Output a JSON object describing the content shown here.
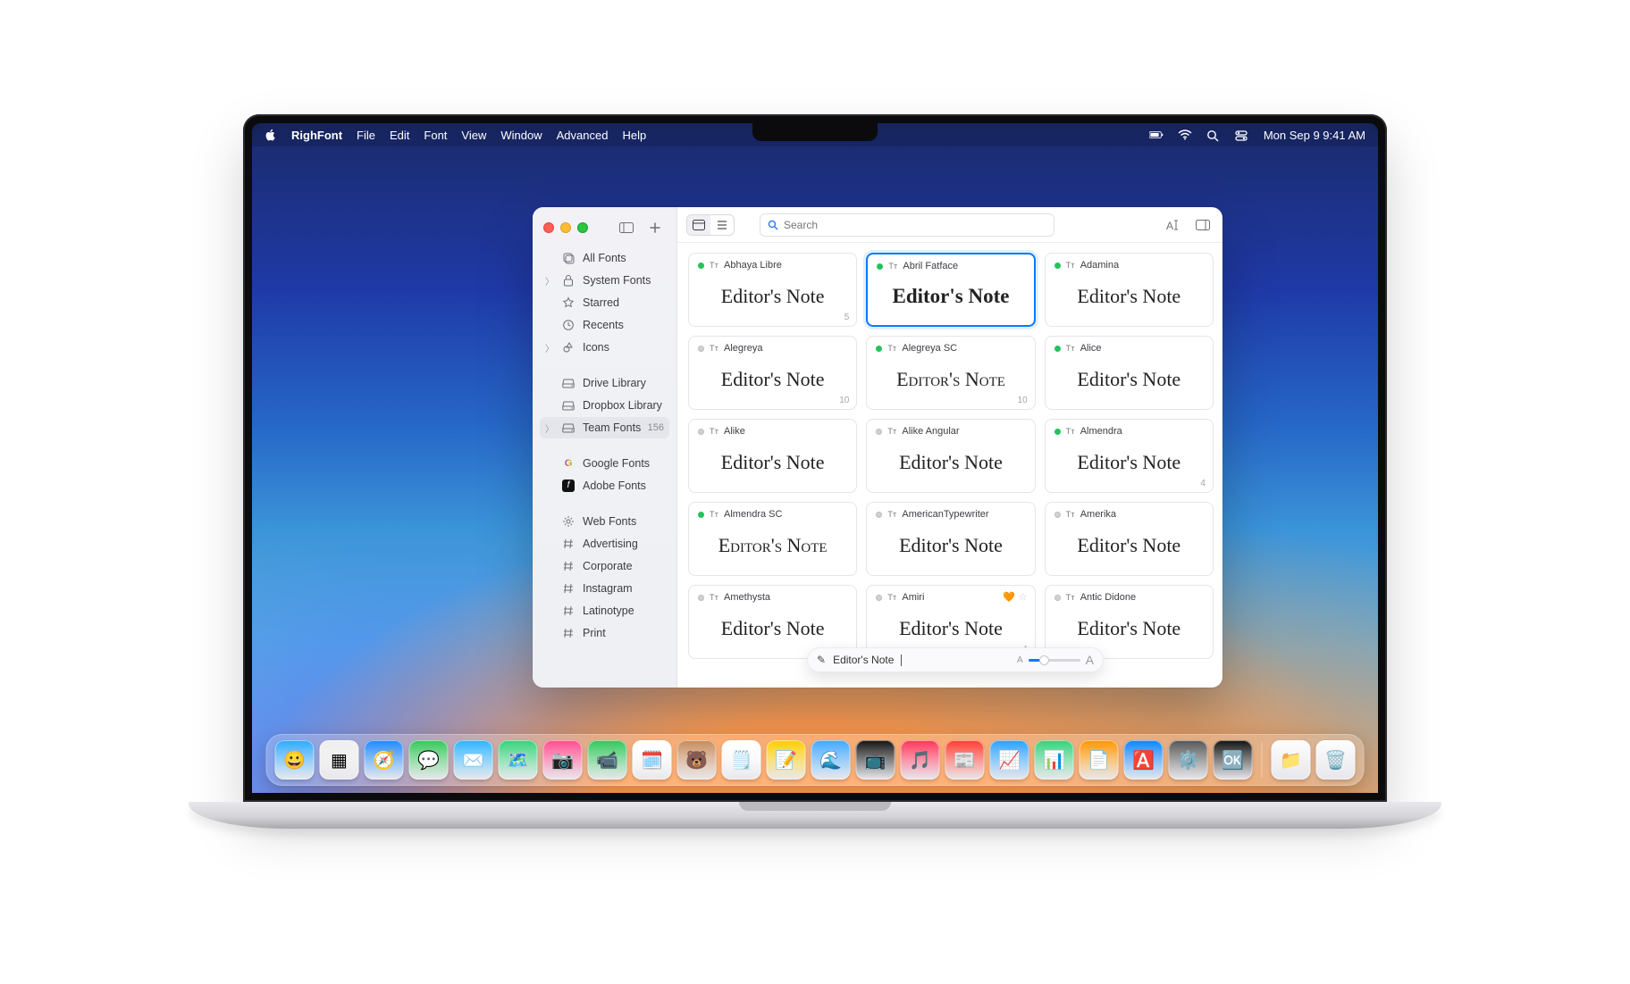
{
  "menubar": {
    "app": "RighFont",
    "items": [
      "File",
      "Edit",
      "Font",
      "View",
      "Window",
      "Advanced",
      "Help"
    ],
    "clock": "Mon Sep 9  9:41 AM"
  },
  "toolbar": {
    "search_placeholder": "Search"
  },
  "sidebar": {
    "primary": [
      {
        "icon": "stack",
        "label": "All Fonts"
      },
      {
        "icon": "lock",
        "label": "System Fonts",
        "expandable": true
      },
      {
        "icon": "star",
        "label": "Starred"
      },
      {
        "icon": "clock",
        "label": "Recents"
      },
      {
        "icon": "shapes",
        "label": "Icons",
        "expandable": true
      }
    ],
    "libs": [
      {
        "icon": "drive",
        "label": "Drive Library"
      },
      {
        "icon": "drive",
        "label": "Dropbox Library"
      },
      {
        "icon": "drive",
        "label": "Team Fonts",
        "count": "156",
        "active": true,
        "expandable": true
      }
    ],
    "sources": [
      {
        "icon": "google",
        "label": "Google Fonts"
      },
      {
        "icon": "adobe",
        "label": "Adobe Fonts"
      }
    ],
    "tags": [
      {
        "icon": "gear",
        "label": "Web Fonts"
      },
      {
        "icon": "hash",
        "label": "Advertising"
      },
      {
        "icon": "hash",
        "label": "Corporate"
      },
      {
        "icon": "hash",
        "label": "Instagram"
      },
      {
        "icon": "hash",
        "label": "Latinotype"
      },
      {
        "icon": "hash",
        "label": "Print"
      }
    ]
  },
  "preview_text": "Editor's Note",
  "preview_popup": {
    "text": "Editor's Note"
  },
  "fonts": [
    {
      "name": "Abhaya Libre",
      "status": "on",
      "count": "5"
    },
    {
      "name": "Abril Fatface",
      "status": "on",
      "selected": true,
      "bold": true
    },
    {
      "name": "Adamina",
      "status": "on"
    },
    {
      "name": "Alegreya",
      "status": "off",
      "count": "10"
    },
    {
      "name": "Alegreya SC",
      "status": "on",
      "sc": true,
      "count": "10"
    },
    {
      "name": "Alice",
      "status": "on"
    },
    {
      "name": "Alike",
      "status": "off"
    },
    {
      "name": "Alike Angular",
      "status": "off"
    },
    {
      "name": "Almendra",
      "status": "on",
      "count": "4"
    },
    {
      "name": "Almendra SC",
      "status": "on",
      "sc": true
    },
    {
      "name": "AmericanTypewriter",
      "status": "off"
    },
    {
      "name": "Amerika",
      "status": "off"
    },
    {
      "name": "Amethysta",
      "status": "off"
    },
    {
      "name": "Amiri",
      "status": "off",
      "badges": true,
      "count": "4"
    },
    {
      "name": "Antic Didone",
      "status": "off"
    }
  ],
  "dock": [
    "😀",
    "▦",
    "🧭",
    "💬",
    "✉️",
    "🗺️",
    "📷",
    "📹",
    "🗓️",
    "🐻",
    "🗒️",
    "📝",
    "🌊",
    "📺",
    "🎵",
    "📰",
    "📈",
    "📊",
    "📄",
    "🅰️",
    "⚙️",
    "🆗",
    "📁",
    "🗑️"
  ]
}
